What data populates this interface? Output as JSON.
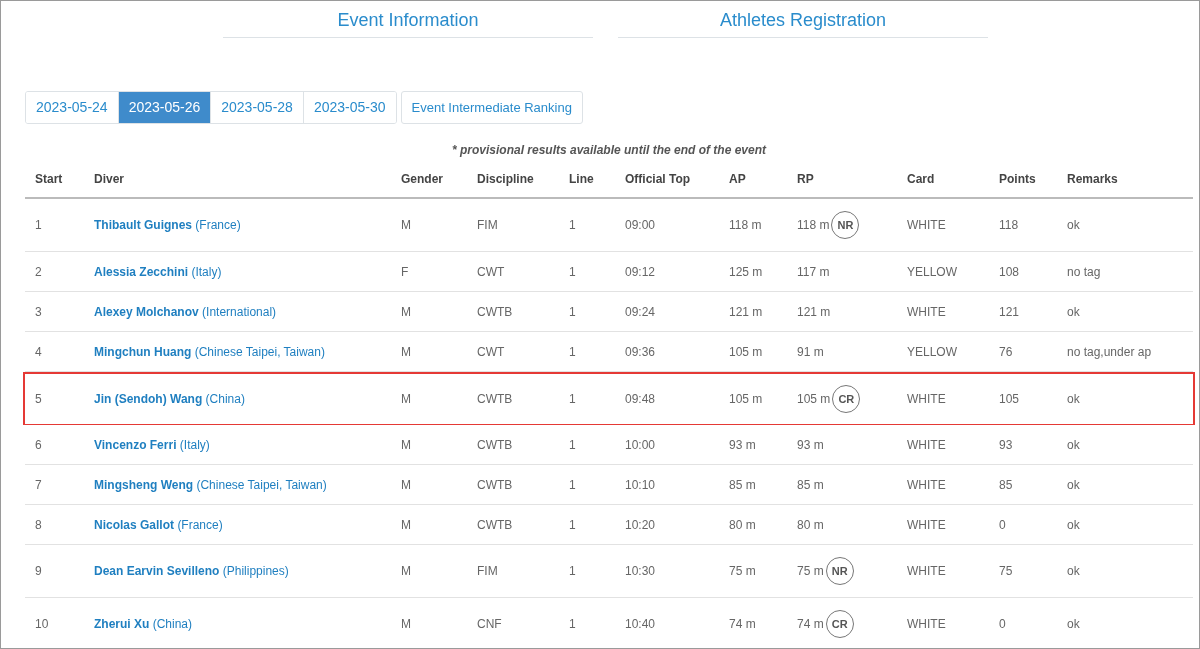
{
  "nav": [
    {
      "label": "Event Information"
    },
    {
      "label": "Athletes Registration"
    }
  ],
  "tabs": [
    {
      "label": "2023-05-24",
      "selected": false
    },
    {
      "label": "2023-05-26",
      "selected": true
    },
    {
      "label": "2023-05-28",
      "selected": false
    },
    {
      "label": "2023-05-30",
      "selected": false
    }
  ],
  "ranking_button": "Event Intermediate Ranking",
  "note": "* provisional results available until the end of the event",
  "table": {
    "columns": [
      "Start",
      "Diver",
      "Gender",
      "Discipline",
      "Line",
      "Official Top",
      "AP",
      "RP",
      "Card",
      "Points",
      "Remarks"
    ],
    "rows": [
      {
        "start": "1",
        "name": "Thibault Guignes",
        "country": "(France)",
        "gender": "M",
        "discipline": "FIM",
        "line": "1",
        "official_top": "09:00",
        "ap": "118 m",
        "rp": "118 m",
        "badge": "NR",
        "card": "WHITE",
        "points": "118",
        "remarks": "ok",
        "highlighted": false
      },
      {
        "start": "2",
        "name": "Alessia Zecchini",
        "country": "(Italy)",
        "gender": "F",
        "discipline": "CWT",
        "line": "1",
        "official_top": "09:12",
        "ap": "125 m",
        "rp": "117 m",
        "card": "YELLOW",
        "points": "108",
        "remarks": "no tag",
        "highlighted": false
      },
      {
        "start": "3",
        "name": "Alexey Molchanov",
        "country": "(International)",
        "gender": "M",
        "discipline": "CWTB",
        "line": "1",
        "official_top": "09:24",
        "ap": "121 m",
        "rp": "121 m",
        "card": "WHITE",
        "points": "121",
        "remarks": "ok",
        "highlighted": false
      },
      {
        "start": "4",
        "name": "Mingchun Huang",
        "country": "(Chinese Taipei, Taiwan)",
        "gender": "M",
        "discipline": "CWT",
        "line": "1",
        "official_top": "09:36",
        "ap": "105 m",
        "rp": "91 m",
        "card": "YELLOW",
        "points": "76",
        "remarks": "no tag,under ap",
        "highlighted": false
      },
      {
        "start": "5",
        "name": "Jin (Sendoh) Wang",
        "country": "(China)",
        "gender": "M",
        "discipline": "CWTB",
        "line": "1",
        "official_top": "09:48",
        "ap": "105 m",
        "rp": "105 m",
        "badge": "CR",
        "card": "WHITE",
        "points": "105",
        "remarks": "ok",
        "highlighted": true
      },
      {
        "start": "6",
        "name": "Vincenzo Ferri",
        "country": "(Italy)",
        "gender": "M",
        "discipline": "CWTB",
        "line": "1",
        "official_top": "10:00",
        "ap": "93 m",
        "rp": "93 m",
        "card": "WHITE",
        "points": "93",
        "remarks": "ok",
        "highlighted": false
      },
      {
        "start": "7",
        "name": "Mingsheng Weng",
        "country": "(Chinese Taipei, Taiwan)",
        "gender": "M",
        "discipline": "CWTB",
        "line": "1",
        "official_top": "10:10",
        "ap": "85 m",
        "rp": "85 m",
        "card": "WHITE",
        "points": "85",
        "remarks": "ok",
        "highlighted": false
      },
      {
        "start": "8",
        "name": "Nicolas Gallot",
        "country": "(France)",
        "gender": "M",
        "discipline": "CWTB",
        "line": "1",
        "official_top": "10:20",
        "ap": "80 m",
        "rp": "80 m",
        "card": "WHITE",
        "points": "0",
        "remarks": "ok",
        "highlighted": false
      },
      {
        "start": "9",
        "name": "Dean Earvin Sevilleno",
        "country": "(Philippines)",
        "gender": "M",
        "discipline": "FIM",
        "line": "1",
        "official_top": "10:30",
        "ap": "75 m",
        "rp": "75 m",
        "badge": "NR",
        "card": "WHITE",
        "points": "75",
        "remarks": "ok",
        "highlighted": false
      },
      {
        "start": "10",
        "name": "Zherui Xu",
        "country": "(China)",
        "gender": "M",
        "discipline": "CNF",
        "line": "1",
        "official_top": "10:40",
        "ap": "74 m",
        "rp": "74 m",
        "badge": "CR",
        "card": "WHITE",
        "points": "0",
        "remarks": "ok",
        "highlighted": false
      }
    ]
  }
}
